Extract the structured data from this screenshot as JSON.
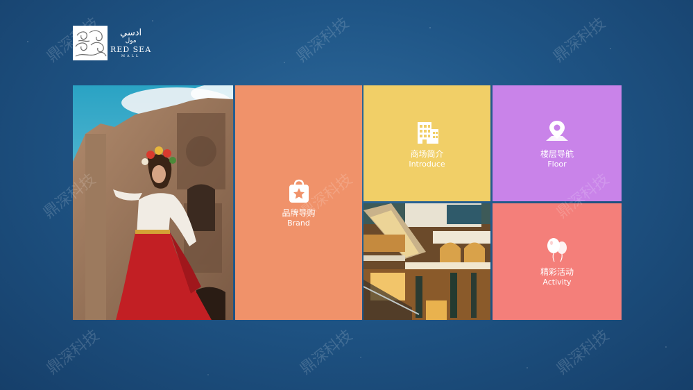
{
  "logo": {
    "arabic_name": "ادسي",
    "arabic_sub": "مول",
    "name": "RED SEA",
    "mall": "MALL"
  },
  "watermark": "鼎深科技",
  "tiles": {
    "brand": {
      "cn": "品牌导购",
      "en": "Brand",
      "icon": "shopping-bag-star-icon",
      "color": "#f0926a"
    },
    "intro": {
      "cn": "商场简介",
      "en": "Introduce",
      "icon": "building-icon",
      "color": "#f1cf67"
    },
    "floor": {
      "cn": "楼层导航",
      "en": "Floor",
      "icon": "map-pin-icon",
      "color": "#c983e9"
    },
    "activity": {
      "cn": "精彩活动",
      "en": "Activity",
      "icon": "balloons-icon",
      "color": "#f47f7a"
    }
  },
  "images": {
    "left_photo": "woman-red-skirt-historic-facade-image",
    "mall_photo": "mall-interior-atrium-image"
  }
}
